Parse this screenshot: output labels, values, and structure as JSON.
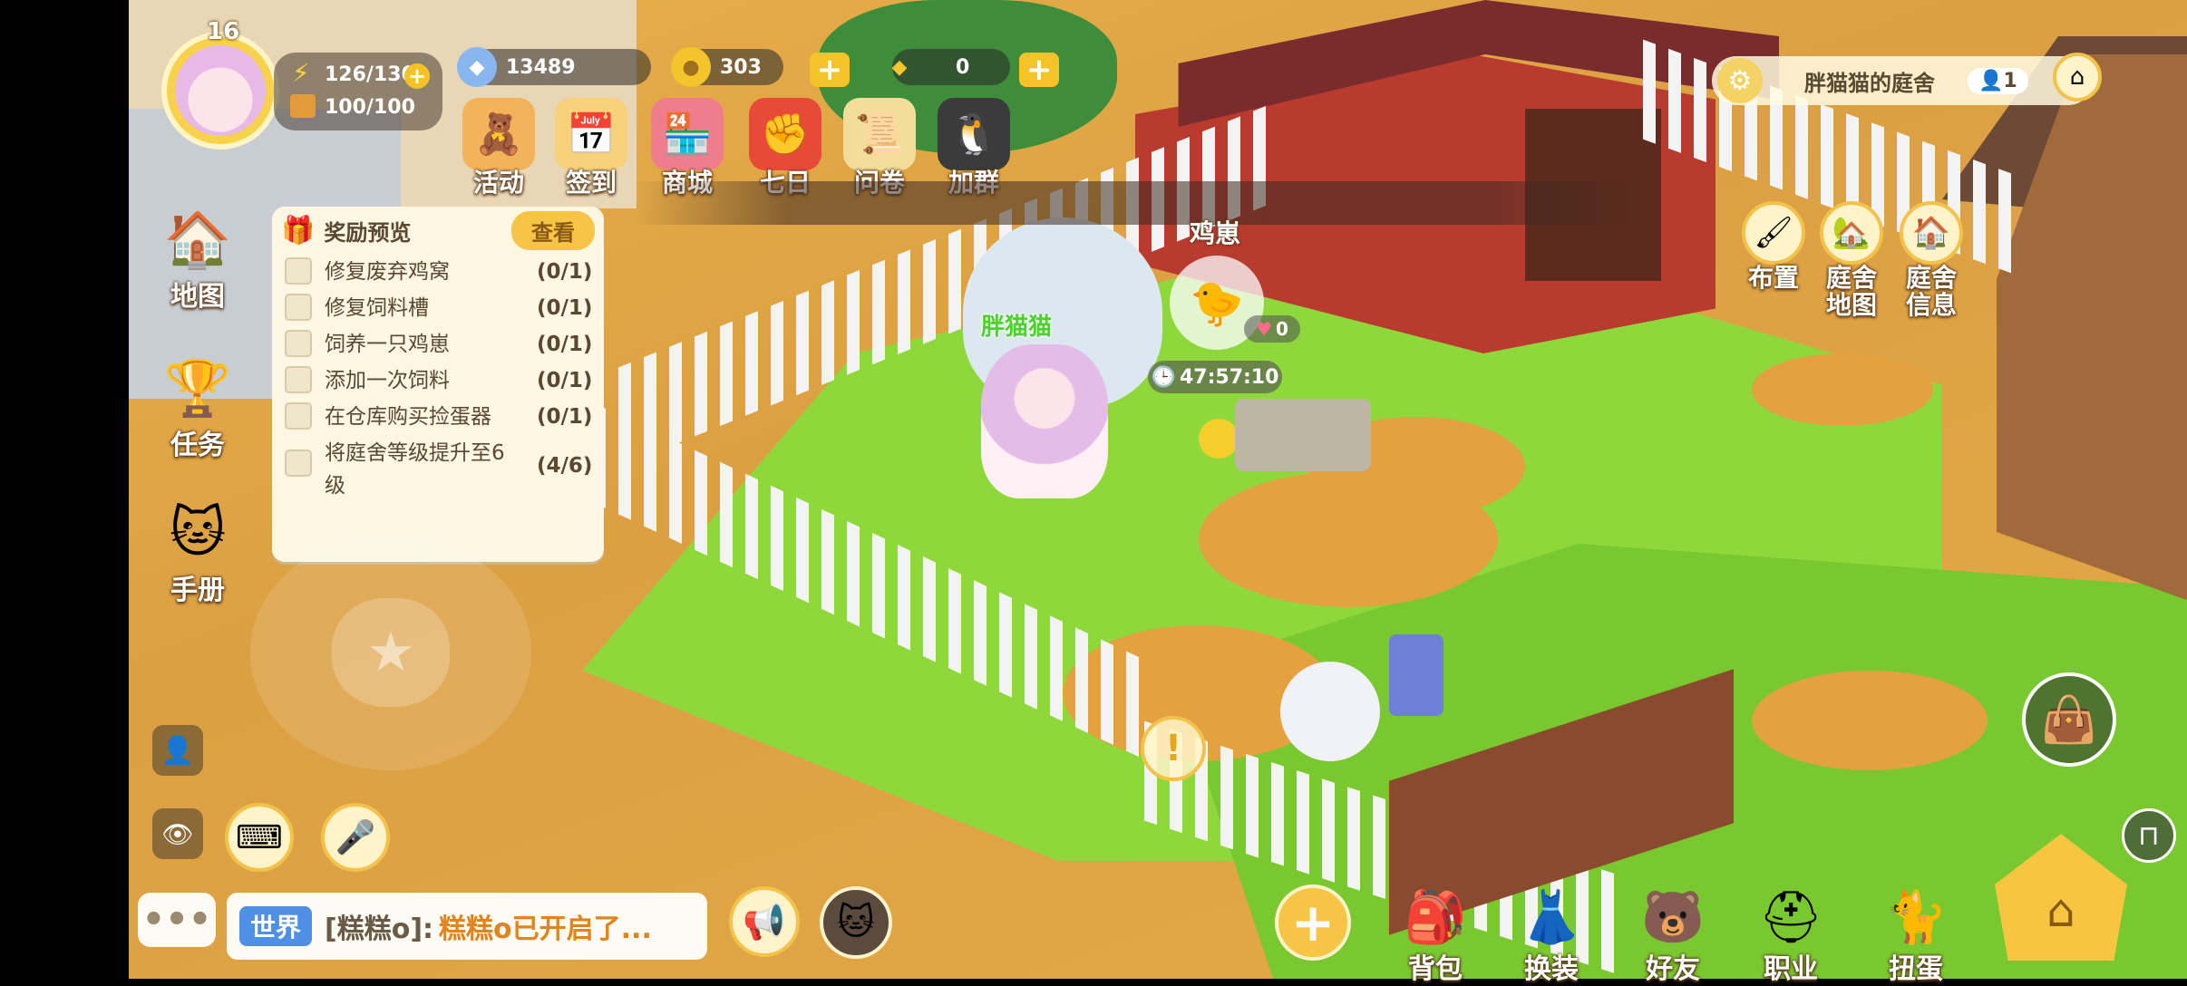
{
  "player": {
    "level": "16",
    "energy": "126/130",
    "storage": "100/100",
    "name": "胖猫猫"
  },
  "currencies": {
    "gems": "13489",
    "coins": "303",
    "diamonds": "0"
  },
  "top_menu": [
    {
      "label": "活动",
      "icon": "teddy-gift-icon",
      "color": "#f3b35a"
    },
    {
      "label": "签到",
      "icon": "calendar-icon",
      "color": "#f7d27a"
    },
    {
      "label": "商城",
      "icon": "shop-stall-icon",
      "color": "#f07d8c"
    },
    {
      "label": "七日",
      "icon": "fist-badge-icon",
      "color": "#e84a3a"
    },
    {
      "label": "问卷",
      "icon": "scroll-icon",
      "color": "#f2dd9a"
    },
    {
      "label": "加群",
      "icon": "penguin-icon",
      "color": "#3b3b3b"
    }
  ],
  "left_menu": [
    {
      "label": "地图",
      "icon": "map-house-icon"
    },
    {
      "label": "任务",
      "icon": "trophy-task-icon"
    },
    {
      "label": "手册",
      "icon": "cat-statue-icon"
    }
  ],
  "quest_panel": {
    "title": "奖励预览",
    "view_button": "查看",
    "tasks": [
      {
        "text": "修复废弃鸡窝",
        "progress": "(0/1)"
      },
      {
        "text": "修复饲料槽",
        "progress": "(0/1)"
      },
      {
        "text": "饲养一只鸡崽",
        "progress": "(0/1)"
      },
      {
        "text": "添加一次饲料",
        "progress": "(0/1)"
      },
      {
        "text": "在仓库购买捡蛋器",
        "progress": "(0/1)"
      },
      {
        "text": "将庭舍等级提升至6级",
        "progress": "(4/6)"
      }
    ]
  },
  "courtyard": {
    "title": "胖猫猫的庭舍",
    "visitors": "1"
  },
  "right_menu": [
    {
      "label": "布置",
      "icon": "paint-roller-icon"
    },
    {
      "label": "庭舍地图",
      "icon": "house-map-icon"
    },
    {
      "label": "庭舍信息",
      "icon": "house-info-icon"
    }
  ],
  "coop": {
    "label": "鸡崽",
    "timer": "47:57:10",
    "likes": "0"
  },
  "bottom_menu": [
    {
      "label": "背包",
      "icon": "backpack-icon"
    },
    {
      "label": "换装",
      "icon": "dress-icon"
    },
    {
      "label": "好友",
      "icon": "friend-bear-icon"
    },
    {
      "label": "职业",
      "icon": "career-helmet-icon"
    },
    {
      "label": "扭蛋",
      "icon": "gacha-cat-icon"
    }
  ],
  "chat": {
    "channel": "世界",
    "message_sender": "[糕糕o]:",
    "message_text": "糕糕o已开启了..."
  }
}
